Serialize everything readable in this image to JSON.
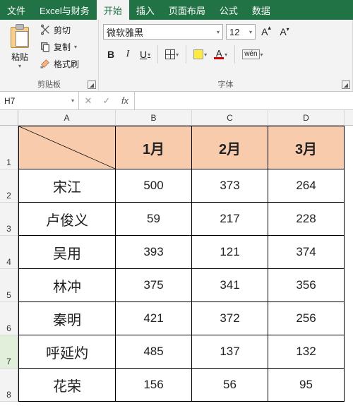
{
  "menu": {
    "tabs": [
      "文件",
      "Excel与财务",
      "开始",
      "插入",
      "页面布局",
      "公式",
      "数据"
    ],
    "active_index": 2
  },
  "ribbon": {
    "clipboard": {
      "paste": "粘贴",
      "cut": "剪切",
      "copy": "复制",
      "format_painter": "格式刷",
      "group_label": "剪贴板"
    },
    "font": {
      "font_name": "微软雅黑",
      "font_size": "12",
      "bold": "B",
      "italic": "I",
      "underline": "U",
      "font_color_letter": "A",
      "wen": "wén",
      "group_label": "字体"
    }
  },
  "formula_bar": {
    "name_box": "H7",
    "formula": ""
  },
  "sheet": {
    "columns": [
      "A",
      "B",
      "C",
      "D"
    ],
    "row_numbers": [
      "1",
      "2",
      "3",
      "4",
      "5",
      "6",
      "7",
      "8"
    ],
    "header_row": {
      "a1_diagonal": true,
      "b1": "1月",
      "c1": "2月",
      "d1": "3月"
    },
    "rows": [
      {
        "name": "宋江",
        "m1": "500",
        "m2": "373",
        "m3": "264"
      },
      {
        "name": "卢俊义",
        "m1": "59",
        "m2": "217",
        "m3": "228"
      },
      {
        "name": "吴用",
        "m1": "393",
        "m2": "121",
        "m3": "374"
      },
      {
        "name": "林冲",
        "m1": "375",
        "m2": "341",
        "m3": "356"
      },
      {
        "name": "秦明",
        "m1": "421",
        "m2": "372",
        "m3": "256"
      },
      {
        "name": "呼延灼",
        "m1": "485",
        "m2": "137",
        "m3": "132"
      },
      {
        "name": "花荣",
        "m1": "156",
        "m2": "56",
        "m3": "95"
      }
    ],
    "selected_cell": "H7"
  },
  "chart_data": {
    "type": "table",
    "title": "",
    "columns": [
      "1月",
      "2月",
      "3月"
    ],
    "index": [
      "宋江",
      "卢俊义",
      "吴用",
      "林冲",
      "秦明",
      "呼延灼",
      "花荣"
    ],
    "values": [
      [
        500,
        373,
        264
      ],
      [
        59,
        217,
        228
      ],
      [
        393,
        121,
        374
      ],
      [
        375,
        341,
        356
      ],
      [
        421,
        372,
        256
      ],
      [
        485,
        137,
        132
      ],
      [
        156,
        56,
        95
      ]
    ]
  }
}
